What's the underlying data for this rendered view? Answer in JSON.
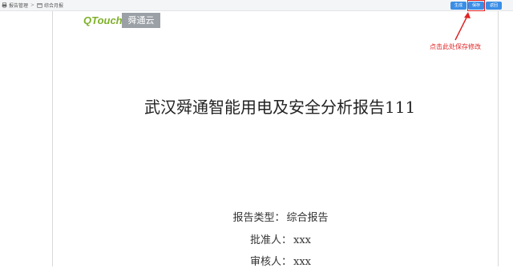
{
  "breadcrumb": {
    "item1": "报告管理",
    "separator": ">",
    "item2": "综合月报"
  },
  "toolbar": {
    "generate_label": "生成",
    "save_label": "保存",
    "back_label": "返回"
  },
  "logo": {
    "brand_en": "QTouch",
    "brand_cn": "舜通云"
  },
  "report": {
    "title": "武汉舜通智能用电及安全分析报告111",
    "type_label": "报告类型：",
    "type_value": "综合报告",
    "approver_label": "批准人：",
    "approver_value": "xxx",
    "reviewer_label": "审核人：",
    "reviewer_value": "xxx"
  },
  "annotation": {
    "text": "点击此处保存修改"
  },
  "colors": {
    "button_blue": "#3a8ee6",
    "annotation_red": "#e02424",
    "logo_green": "#7fb02a"
  }
}
